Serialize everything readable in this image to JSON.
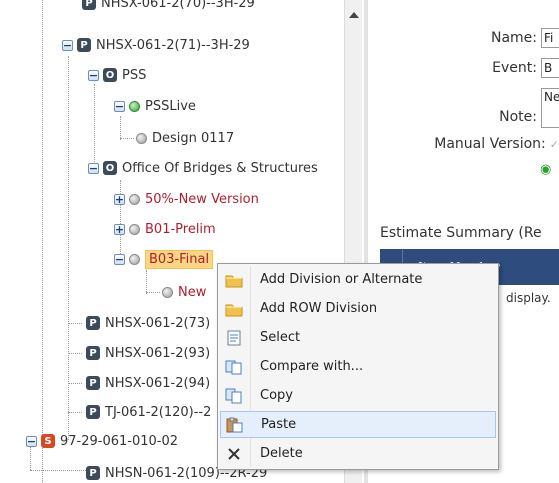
{
  "tree": {
    "top_partial_label": "NHSX-061-2(70)--3H-29",
    "nodes": {
      "n71": "NHSX-061-2(71)--3H-29",
      "pss": "PSS",
      "psslive": "PSSLive",
      "design0117": "Design 0117",
      "office": "Office Of Bridges & Structures",
      "v50": "50%-New Version",
      "b01": "B01-Prelim",
      "b03": "B03-Final",
      "newv": "New",
      "n73": "NHSX-061-2(73)",
      "n93": "NHSX-061-2(93)",
      "n94": "NHSX-061-2(94)",
      "tj": "TJ-061-2(120)--2",
      "s97": "97-29-061-010-02",
      "nhsn": "NHSN-061-2(109)--2R-29"
    },
    "badges": {
      "p": "P",
      "o": "O",
      "s": "S"
    },
    "expander_plus": "+",
    "expander_minus": "−"
  },
  "details": {
    "name_label": "Name:",
    "name_value": "Fi",
    "event_label": "Event:",
    "event_value": "B",
    "note_label": "Note:",
    "note_value": "Ne",
    "manual_label": "Manual Version:",
    "manual_check": "✓",
    "radio_symbol": "◉"
  },
  "estimate": {
    "title": "Estimate Summary (Re",
    "column_item_number": "Item Number",
    "empty_text": "display."
  },
  "context_menu": {
    "items": [
      {
        "label": "Add Division or Alternate",
        "icon": "folder-icon"
      },
      {
        "label": "Add ROW Division",
        "icon": "folder-icon"
      },
      {
        "label": "Select",
        "icon": "select-icon"
      },
      {
        "label": "Compare with...",
        "icon": "compare-icon"
      },
      {
        "label": "Copy",
        "icon": "copy-icon"
      },
      {
        "label": "Paste",
        "icon": "paste-icon"
      },
      {
        "label": "Delete",
        "icon": "delete-icon"
      }
    ],
    "hover_index": 5
  },
  "colors": {
    "tree_link_red": "#b01e2e",
    "selection_bg": "#fcd683",
    "grid_header": "#2e4c7e",
    "menu_hover": "#e5effb"
  }
}
